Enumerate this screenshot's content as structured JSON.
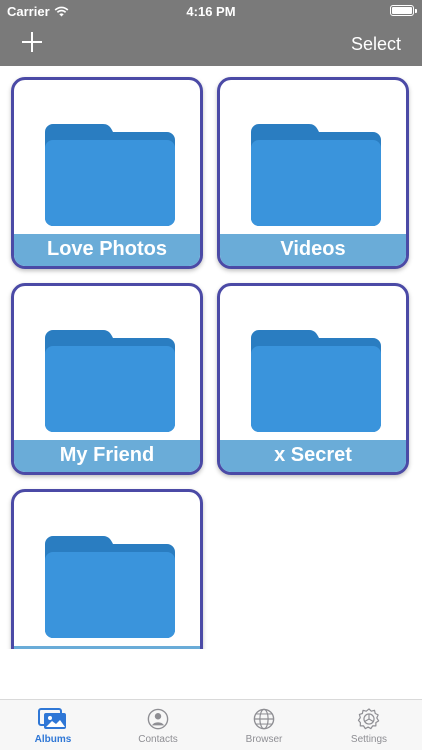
{
  "status_bar": {
    "carrier": "Carrier",
    "time": "4:16 PM"
  },
  "nav": {
    "select_label": "Select",
    "add_icon": "plus-icon"
  },
  "albums": [
    {
      "name": "Love Photos"
    },
    {
      "name": "Videos"
    },
    {
      "name": "My Friend"
    },
    {
      "name": "x Secret"
    },
    {
      "name": ""
    }
  ],
  "tabs": [
    {
      "label": "Albums",
      "icon": "photos-icon",
      "active": true
    },
    {
      "label": "Contacts",
      "icon": "person-icon",
      "active": false
    },
    {
      "label": "Browser",
      "icon": "globe-icon",
      "active": false
    },
    {
      "label": "Settings",
      "icon": "gear-icon",
      "active": false
    }
  ],
  "colors": {
    "bar": "#7a7a7a",
    "album_border": "#4b4aa6",
    "label_band": "#6aacd8",
    "folder_front": "#3a94dc",
    "folder_back": "#2a7dc1",
    "tab_active": "#2f77d6",
    "tab_inactive": "#8e8e93"
  }
}
